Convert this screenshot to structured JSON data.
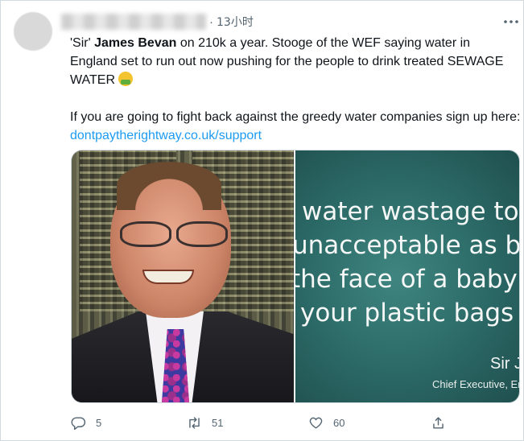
{
  "tweet": {
    "time": "13小时",
    "dot": "·",
    "more_icon": "ellipsis-icon",
    "text": {
      "part1_prefix": "'Sir' ",
      "part1_bold": "James Bevan",
      "part1_rest": " on 210k a year. Stooge of the WEF saying water in England set to run out now pushing for the people to drink treated SEWAGE WATER ",
      "emoji": "nauseated-face-emoji",
      "part2_text": "If you are going to fight back against the greedy water companies sign up here: ",
      "part2_link": "dontpaytherightway.co.uk/support"
    },
    "media": {
      "quote_lines": [
        "water wastage to b",
        "unacceptable as blo",
        "the face of a baby",
        "your plastic bags in"
      ],
      "sig_name": "Sir J",
      "sig_title": "Chief Executive, En"
    },
    "actions": {
      "reply_count": "5",
      "retweet_count": "51",
      "like_count": "60"
    }
  },
  "colors": {
    "link": "#1d9bf0",
    "muted": "#536471",
    "text": "#0f1419",
    "quote_bg": "#2c6b68"
  }
}
